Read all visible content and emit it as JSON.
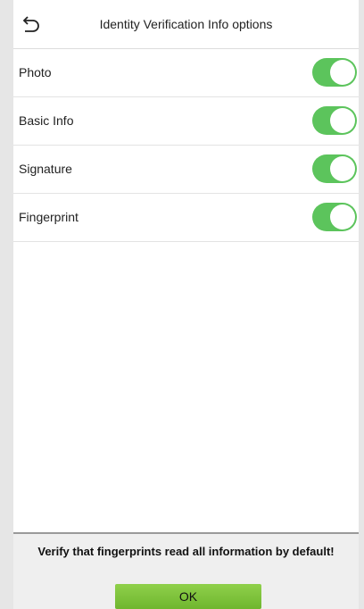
{
  "header": {
    "title": "Identity Verification Info options",
    "back_icon": "back-arrow-icon"
  },
  "options": [
    {
      "label": "Photo",
      "enabled": true
    },
    {
      "label": "Basic Info",
      "enabled": true
    },
    {
      "label": "Signature",
      "enabled": true
    },
    {
      "label": "Fingerprint",
      "enabled": true
    }
  ],
  "footer": {
    "message": "Verify that fingerprints read all information by default!",
    "ok_label": "OK"
  },
  "colors": {
    "toggle_on": "#5cc45c",
    "ok_button": "#7cc23b"
  }
}
